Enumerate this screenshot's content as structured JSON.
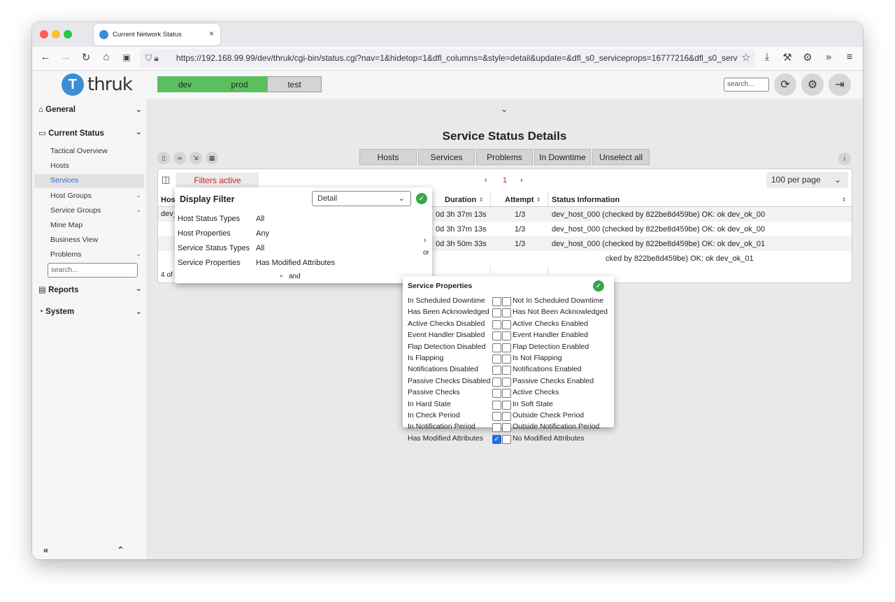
{
  "browser": {
    "tab_title": "Current Network Status",
    "tab_close": "×",
    "url": "https://192.168.99.99/dev/thruk/cgi-bin/status.cgi?nav=1&hidetop=1&dfl_columns=&style=detail&update=&dfl_s0_serviceprops=16777216&dfl_s0_serv"
  },
  "logo": {
    "text": "thruk"
  },
  "sidebar": {
    "general": "General",
    "current_status": "Current Status",
    "items": [
      {
        "label": "Tactical Overview"
      },
      {
        "label": "Hosts"
      },
      {
        "label": "Services"
      },
      {
        "label": "Host Groups"
      },
      {
        "label": "Service Groups"
      },
      {
        "label": "Mine Map"
      },
      {
        "label": "Business View"
      },
      {
        "label": "Problems"
      }
    ],
    "search_placeholder": "search...",
    "reports": "Reports",
    "system": "System",
    "collapse": "«",
    "scroll_top": "⌃"
  },
  "topbar": {
    "sites": [
      {
        "label": "dev"
      },
      {
        "label": "prod"
      },
      {
        "label": "test"
      }
    ],
    "search_placeholder": "search..."
  },
  "main": {
    "title": "Service Status Details",
    "quick_buttons": [
      {
        "label": "Hosts"
      },
      {
        "label": "Services"
      },
      {
        "label": "Problems"
      },
      {
        "label": "In Downtime"
      },
      {
        "label": "Unselect all"
      }
    ],
    "filters_active": "Filters active",
    "pager": {
      "prev": "‹",
      "page": "1",
      "next": "›"
    },
    "per_page": "100 per page",
    "info": "i",
    "table": {
      "headers": {
        "host": "Hos",
        "duration": "Duration",
        "attempt": "Attempt",
        "status_info": "Status Information"
      },
      "rows": [
        {
          "host": "dev_",
          "duration": "0d 3h 37m 13s",
          "attempt": "1/3",
          "info": "dev_host_000 (checked by 822be8d459be) OK: ok dev_ok_00"
        },
        {
          "host": "",
          "duration": "0d 3h 37m 13s",
          "attempt": "1/3",
          "info": "dev_host_000 (checked by 822be8d459be) OK: ok dev_ok_00"
        },
        {
          "host": "",
          "duration": "0d 3h 50m 33s",
          "attempt": "1/3",
          "info": "dev_host_000 (checked by 822be8d459be) OK: ok dev_ok_01"
        },
        {
          "host": "",
          "duration": "",
          "attempt": "",
          "info": "cked by 822be8d459be) OK: ok dev_ok_01"
        }
      ],
      "footer": "4 of"
    }
  },
  "display_filter": {
    "title": "Display Filter",
    "mode": "Detail",
    "rows": [
      {
        "label": "Host Status Types",
        "value": "All"
      },
      {
        "label": "Host Properties",
        "value": "Any"
      },
      {
        "label": "Service Status Types",
        "value": "All"
      },
      {
        "label": "Service Properties",
        "value": "Has Modified Attributes"
      }
    ],
    "or_label": "or",
    "and_label": "and"
  },
  "service_properties": {
    "title": "Service Properties",
    "rows": [
      {
        "left": "In Scheduled Downtime",
        "right": "Not In Scheduled Downtime",
        "checked": false
      },
      {
        "left": "Has Been Acknowledged",
        "right": "Has Not Been Acknowledged",
        "checked": false
      },
      {
        "left": "Active Checks Disabled",
        "right": "Active Checks Enabled",
        "checked": false
      },
      {
        "left": "Event Handler Disabled",
        "right": "Event Handler Enabled",
        "checked": false
      },
      {
        "left": "Flap Detection Disabled",
        "right": "Flap Detection Enabled",
        "checked": false
      },
      {
        "left": "Is Flapping",
        "right": "Is Not Flapping",
        "checked": false
      },
      {
        "left": "Notifications Disabled",
        "right": "Notifications Enabled",
        "checked": false
      },
      {
        "left": "Passive Checks Disabled",
        "right": "Passive Checks Enabled",
        "checked": false
      },
      {
        "left": "Passive Checks",
        "right": "Active Checks",
        "checked": false
      },
      {
        "left": "In Hard State",
        "right": "In Soft State",
        "checked": false
      },
      {
        "left": "In Check Period",
        "right": "Outside Check Period",
        "checked": false
      },
      {
        "left": "In Notification Period",
        "right": "Outside Notification Period",
        "checked": false
      },
      {
        "left": "Has Modified Attributes",
        "right": "No Modified Attributes",
        "checked": true
      }
    ]
  },
  "colors": {
    "site_active": "#5cbf5f",
    "site_inactive": "#d4d4d4",
    "accent_link": "#1f6fe0",
    "filters_active": "#cc2222",
    "ok_check": "#3ba54b"
  }
}
